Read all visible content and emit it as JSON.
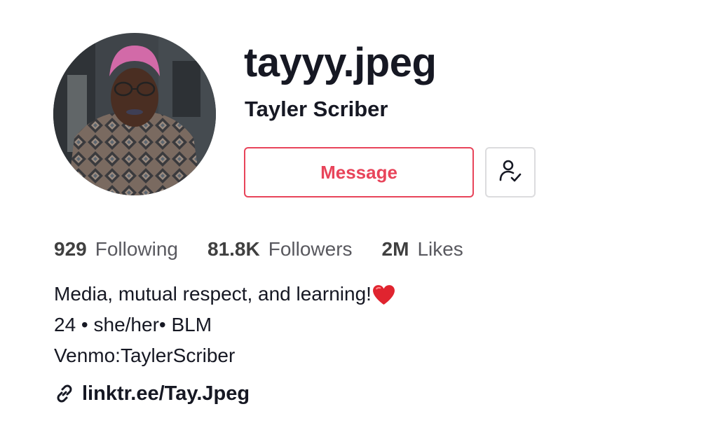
{
  "profile": {
    "username": "tayyy.jpeg",
    "display_name": "Tayler Scriber",
    "message_label": "Message"
  },
  "stats": [
    {
      "value": "929",
      "label": "Following"
    },
    {
      "value": "81.8K",
      "label": "Followers"
    },
    {
      "value": "2M",
      "label": "Likes"
    }
  ],
  "bio": {
    "line1": "Media, mutual respect, and learning!",
    "line2": "24 • she/her• BLM",
    "line3": "Venmo:TaylerScriber"
  },
  "link": {
    "text": "linktr.ee/Tay.Jpeg"
  },
  "icons": {
    "follow_status": "user-check-icon",
    "link": "link-icon",
    "heart": "heart-emoji-icon"
  },
  "colors": {
    "accent": "#e8445a",
    "text": "#161823",
    "secondary_text": "#59595f"
  }
}
